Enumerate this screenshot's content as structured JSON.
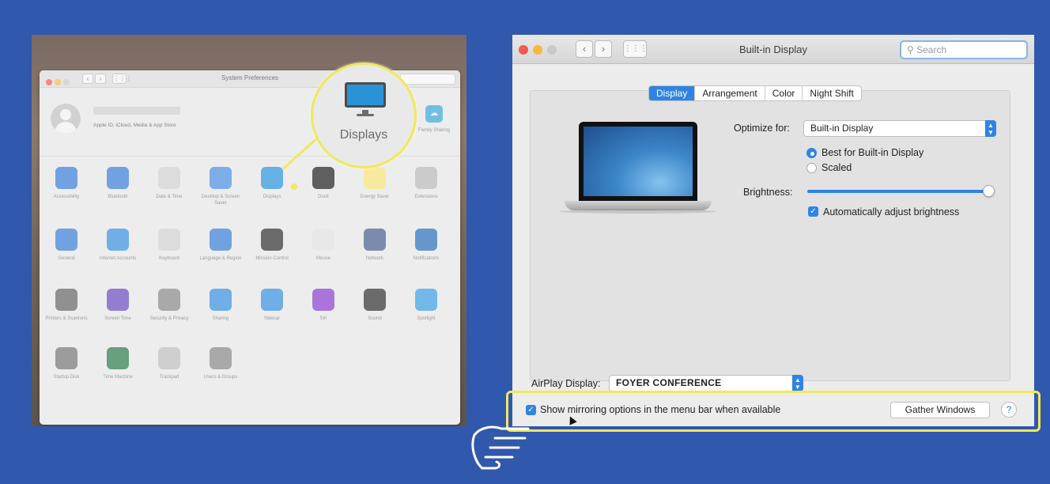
{
  "system_preferences": {
    "title": "System Preferences",
    "apple_id_caption": "Apple ID, iCloud, Media & App Store",
    "family_sharing": "Family Sharing",
    "callout_label": "Displays",
    "rows": [
      [
        {
          "label": "Accessibility",
          "icon": "accessibility-icon",
          "color": "#3a7fd6"
        },
        {
          "label": "Bluetooth",
          "icon": "bluetooth-icon",
          "color": "#3a7fd6"
        },
        {
          "label": "Date & Time",
          "icon": "clock-icon",
          "color": "#cfcfcf"
        },
        {
          "label": "Desktop & Screen Saver",
          "icon": "desktop-icon",
          "color": "#4a8ee0"
        },
        {
          "label": "Displays",
          "icon": "display-icon",
          "color": "#2a93d8"
        },
        {
          "label": "Dock",
          "icon": "dock-icon",
          "color": "#222222"
        },
        {
          "label": "Energy Saver",
          "icon": "bulb-icon",
          "color": "#f4e27a"
        },
        {
          "label": "Extensions",
          "icon": "puzzle-icon",
          "color": "#b8b8b8"
        }
      ],
      [
        {
          "label": "General",
          "icon": "general-icon",
          "color": "#3a7fd6"
        },
        {
          "label": "Internet Accounts",
          "icon": "at-icon",
          "color": "#3a8fe0"
        },
        {
          "label": "Keyboard",
          "icon": "keyboard-icon",
          "color": "#cfcfcf"
        },
        {
          "label": "Language & Region",
          "icon": "flag-icon",
          "color": "#3a7fd6"
        },
        {
          "label": "Mission Control",
          "icon": "mission-control-icon",
          "color": "#333333"
        },
        {
          "label": "Mouse",
          "icon": "mouse-icon",
          "color": "#e0e0e0"
        },
        {
          "label": "Network",
          "icon": "globe-icon",
          "color": "#4a5f8e"
        },
        {
          "label": "Notifications",
          "icon": "notifications-icon",
          "color": "#2a6fb8"
        }
      ],
      [
        {
          "label": "Printers & Scanners",
          "icon": "printer-icon",
          "color": "#666666"
        },
        {
          "label": "Screen Time",
          "icon": "hourglass-icon",
          "color": "#6a4bc0"
        },
        {
          "label": "Security & Privacy",
          "icon": "house-icon",
          "color": "#888888"
        },
        {
          "label": "Sharing",
          "icon": "sharing-icon",
          "color": "#3a8fe0"
        },
        {
          "label": "Sidecar",
          "icon": "sidecar-icon",
          "color": "#3a8fe0"
        },
        {
          "label": "Siri",
          "icon": "siri-icon",
          "color": "#8a3fd0"
        },
        {
          "label": "Sound",
          "icon": "speaker-icon",
          "color": "#333333"
        },
        {
          "label": "Spotlight",
          "icon": "spotlight-icon",
          "color": "#3a9fe0"
        }
      ],
      [
        {
          "label": "Startup Disk",
          "icon": "disk-icon",
          "color": "#777777"
        },
        {
          "label": "Time Machine",
          "icon": "time-machine-icon",
          "color": "#2e7a4a"
        },
        {
          "label": "Trackpad",
          "icon": "trackpad-icon",
          "color": "#bdbdbd"
        },
        {
          "label": "Users & Groups",
          "icon": "users-icon",
          "color": "#888888"
        }
      ]
    ]
  },
  "display_window": {
    "title": "Built-in Display",
    "search_placeholder": "Search",
    "tabs": [
      "Display",
      "Arrangement",
      "Color",
      "Night Shift"
    ],
    "active_tab": "Display",
    "optimize_label": "Optimize for:",
    "optimize_value": "Built-in Display",
    "resolution_options": [
      "Best for Built-in Display",
      "Scaled"
    ],
    "brightness_label": "Brightness:",
    "brightness_level": 1.0,
    "auto_brightness_label": "Automatically adjust brightness",
    "airplay_label": "AirPlay Display:",
    "airplay_value": "FOYER CONFERENCE",
    "mirroring_label": "Show mirroring options in the menu bar when available",
    "gather_button": "Gather Windows",
    "help_button": "?"
  },
  "colors": {
    "background": "#3058ad",
    "highlight": "#f1e85a",
    "accent": "#2f84e3"
  }
}
